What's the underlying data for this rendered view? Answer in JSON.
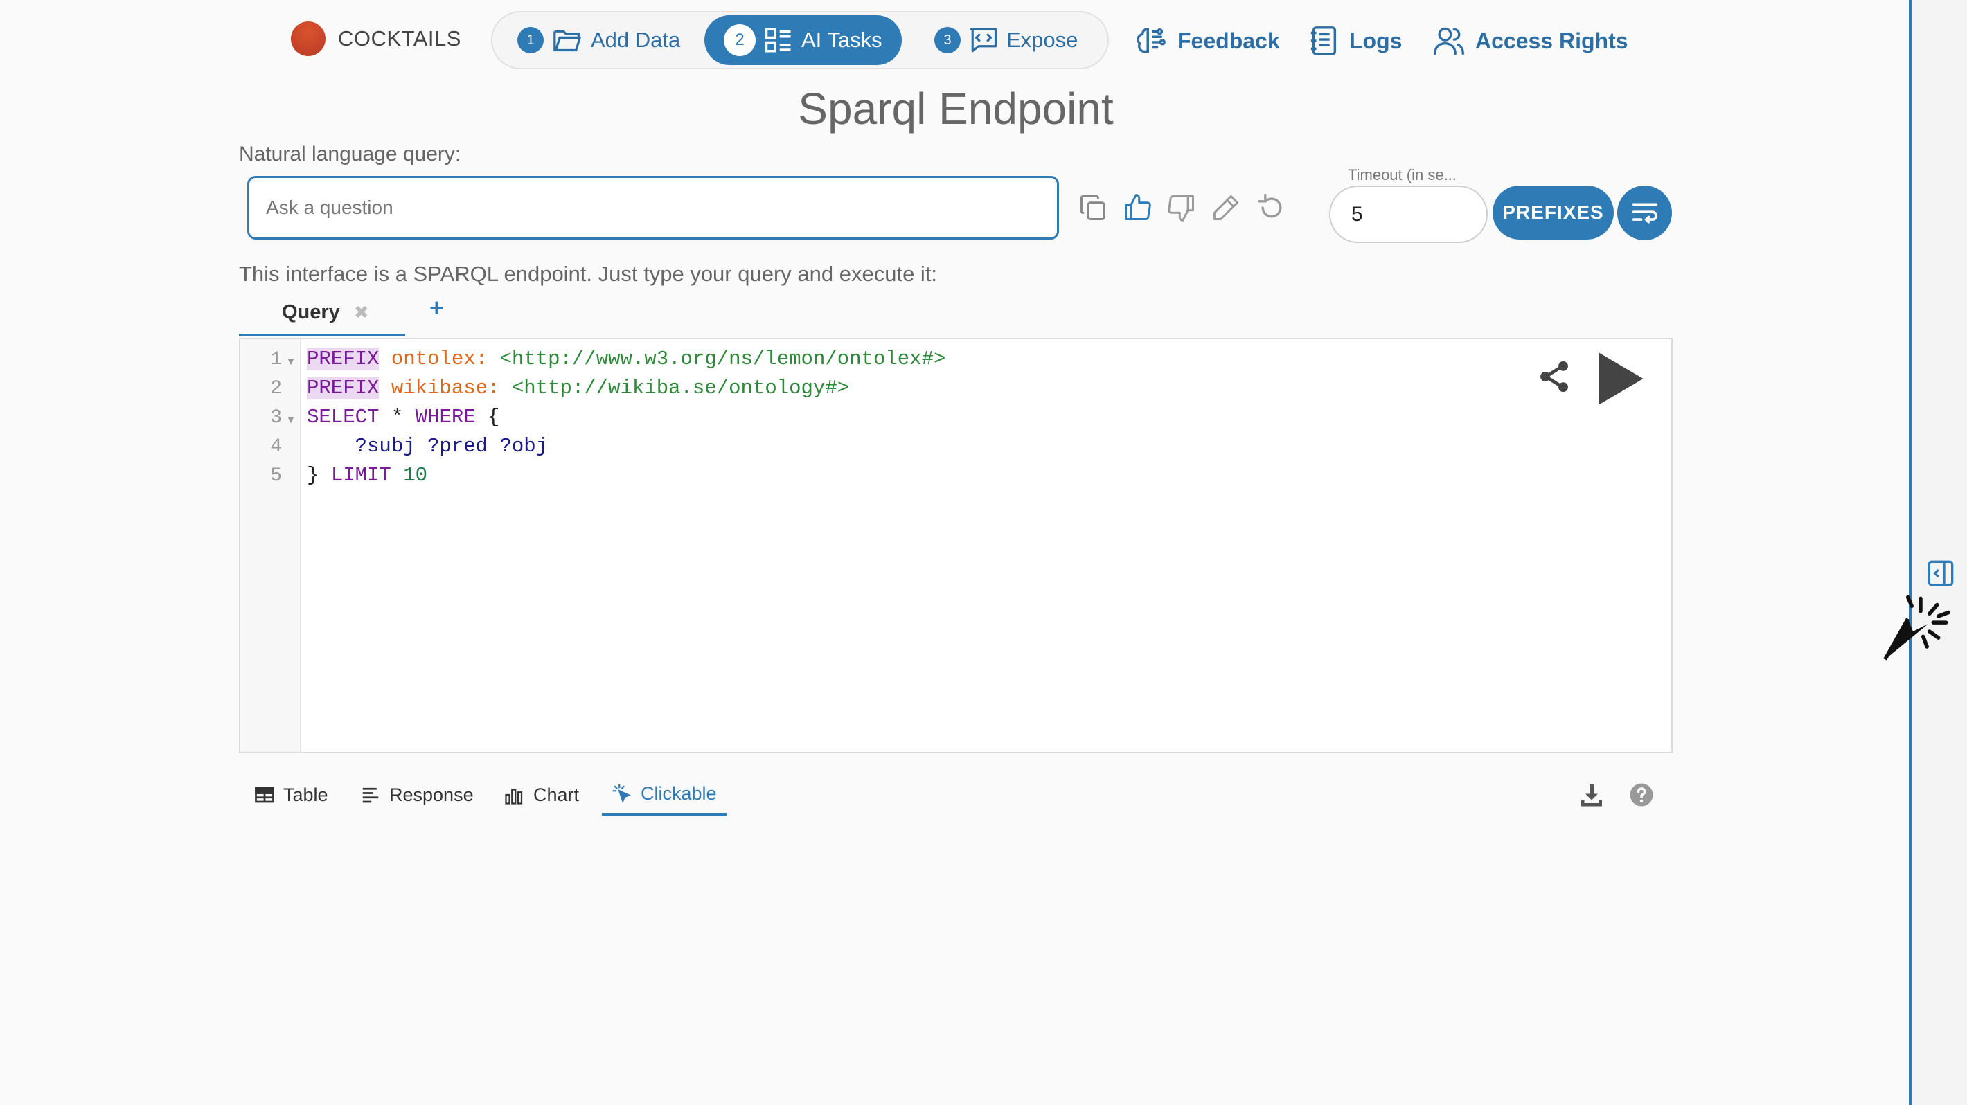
{
  "brand": {
    "name": "COCKTAILS",
    "logo_color": "#c8452a"
  },
  "steps": [
    {
      "number": "1",
      "label": "Add Data",
      "icon": "folder-open-icon",
      "active": false
    },
    {
      "number": "2",
      "label": "AI Tasks",
      "icon": "grid-list-icon",
      "active": true
    },
    {
      "number": "3",
      "label": "Expose",
      "icon": "code-chat-icon",
      "active": false
    }
  ],
  "nav": {
    "feedback": "Feedback",
    "logs": "Logs",
    "access_rights": "Access Rights"
  },
  "page_title": "Sparql Endpoint",
  "nl_query": {
    "label": "Natural language query:",
    "placeholder": "Ask a question",
    "value": ""
  },
  "timeout": {
    "label": "Timeout (in se...",
    "value": "5"
  },
  "prefixes_button": "PREFIXES",
  "hint": "This interface is a SPARQL endpoint. Just type your query and execute it:",
  "query_tabs": [
    {
      "label": "Query",
      "close": "✖"
    }
  ],
  "add_tab": "+",
  "editor": {
    "line_numbers": [
      "1",
      "2",
      "3",
      "4",
      "5"
    ],
    "lines": [
      {
        "kw": "PREFIX",
        "prefix": " ontolex:",
        "uri": " <http://www.w3.org/ns/lemon/ontolex#>"
      },
      {
        "kw": "PREFIX",
        "prefix": " wikibase:",
        "uri": " <http://wikiba.se/ontology#>"
      },
      {
        "kw": "SELECT",
        "rest": " * ",
        "kw2": "WHERE",
        "rest2": " {"
      },
      {
        "vars": "    ?subj ?pred ?obj"
      },
      {
        "brace": "} ",
        "kw": "LIMIT",
        "num": " 10"
      }
    ]
  },
  "result_tabs": [
    {
      "label": "Table",
      "icon": "table-icon",
      "active": false
    },
    {
      "label": "Response",
      "icon": "lines-icon",
      "active": false
    },
    {
      "label": "Chart",
      "icon": "bar-chart-icon",
      "active": false
    },
    {
      "label": "Clickable",
      "icon": "sparkle-pointer-icon",
      "active": true
    }
  ],
  "colors": {
    "accent": "#2f7bb6",
    "keyword": "#7a1a9a",
    "prefix": "#e0681c",
    "uri": "#2e8a3a"
  }
}
